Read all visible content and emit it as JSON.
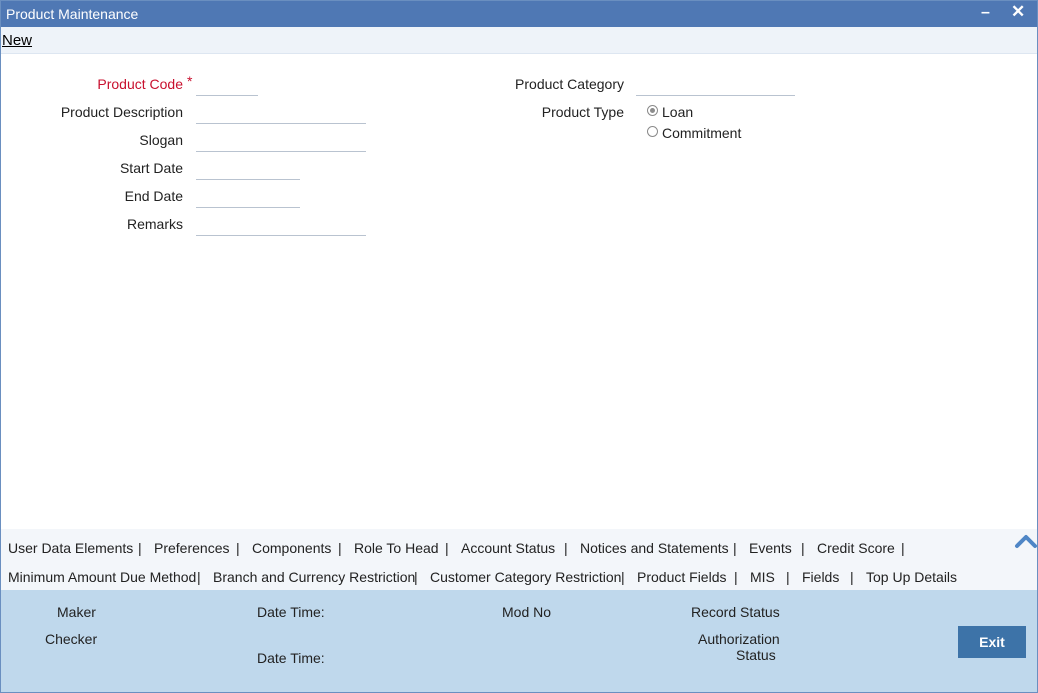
{
  "window": {
    "title": "Product Maintenance",
    "minimize": "–",
    "close": "✕"
  },
  "toolbar": {
    "new_label": "New"
  },
  "form": {
    "product_code_label": "Product Code",
    "required_mark": "*",
    "product_description_label": "Product Description",
    "slogan_label": "Slogan",
    "start_date_label": "Start Date",
    "end_date_label": "End Date",
    "remarks_label": "Remarks",
    "product_category_label": "Product Category",
    "product_type_label": "Product Type",
    "product_type_options": [
      "Loan",
      "Commitment"
    ],
    "product_type_selected": "Loan",
    "values": {
      "product_code": "",
      "product_description": "",
      "slogan": "",
      "start_date": "",
      "end_date": "",
      "remarks": "",
      "product_category": ""
    }
  },
  "tabs": {
    "row1": [
      "User Data Elements",
      "Preferences",
      "Components",
      "Role To Head",
      "Account Status",
      "Notices and Statements",
      "Events",
      "Credit Score"
    ],
    "row2": [
      "Minimum Amount Due Method",
      "Branch and Currency Restriction",
      "Customer Category Restriction",
      "Product Fields",
      "MIS",
      "Fields",
      "Top Up Details"
    ],
    "separator": "|",
    "collapse_icon": "chevron-up-icon"
  },
  "footer": {
    "maker": "Maker",
    "checker": "Checker",
    "date_time": "Date Time:",
    "mod_no": "Mod No",
    "record_status": "Record Status",
    "authorization": "Authorization",
    "status": "Status",
    "exit_label": "Exit"
  },
  "colors": {
    "titlebar": "#4f78b4",
    "footer": "#bfd8ec",
    "exit_button": "#3d73a8",
    "required": "#c8102e"
  }
}
